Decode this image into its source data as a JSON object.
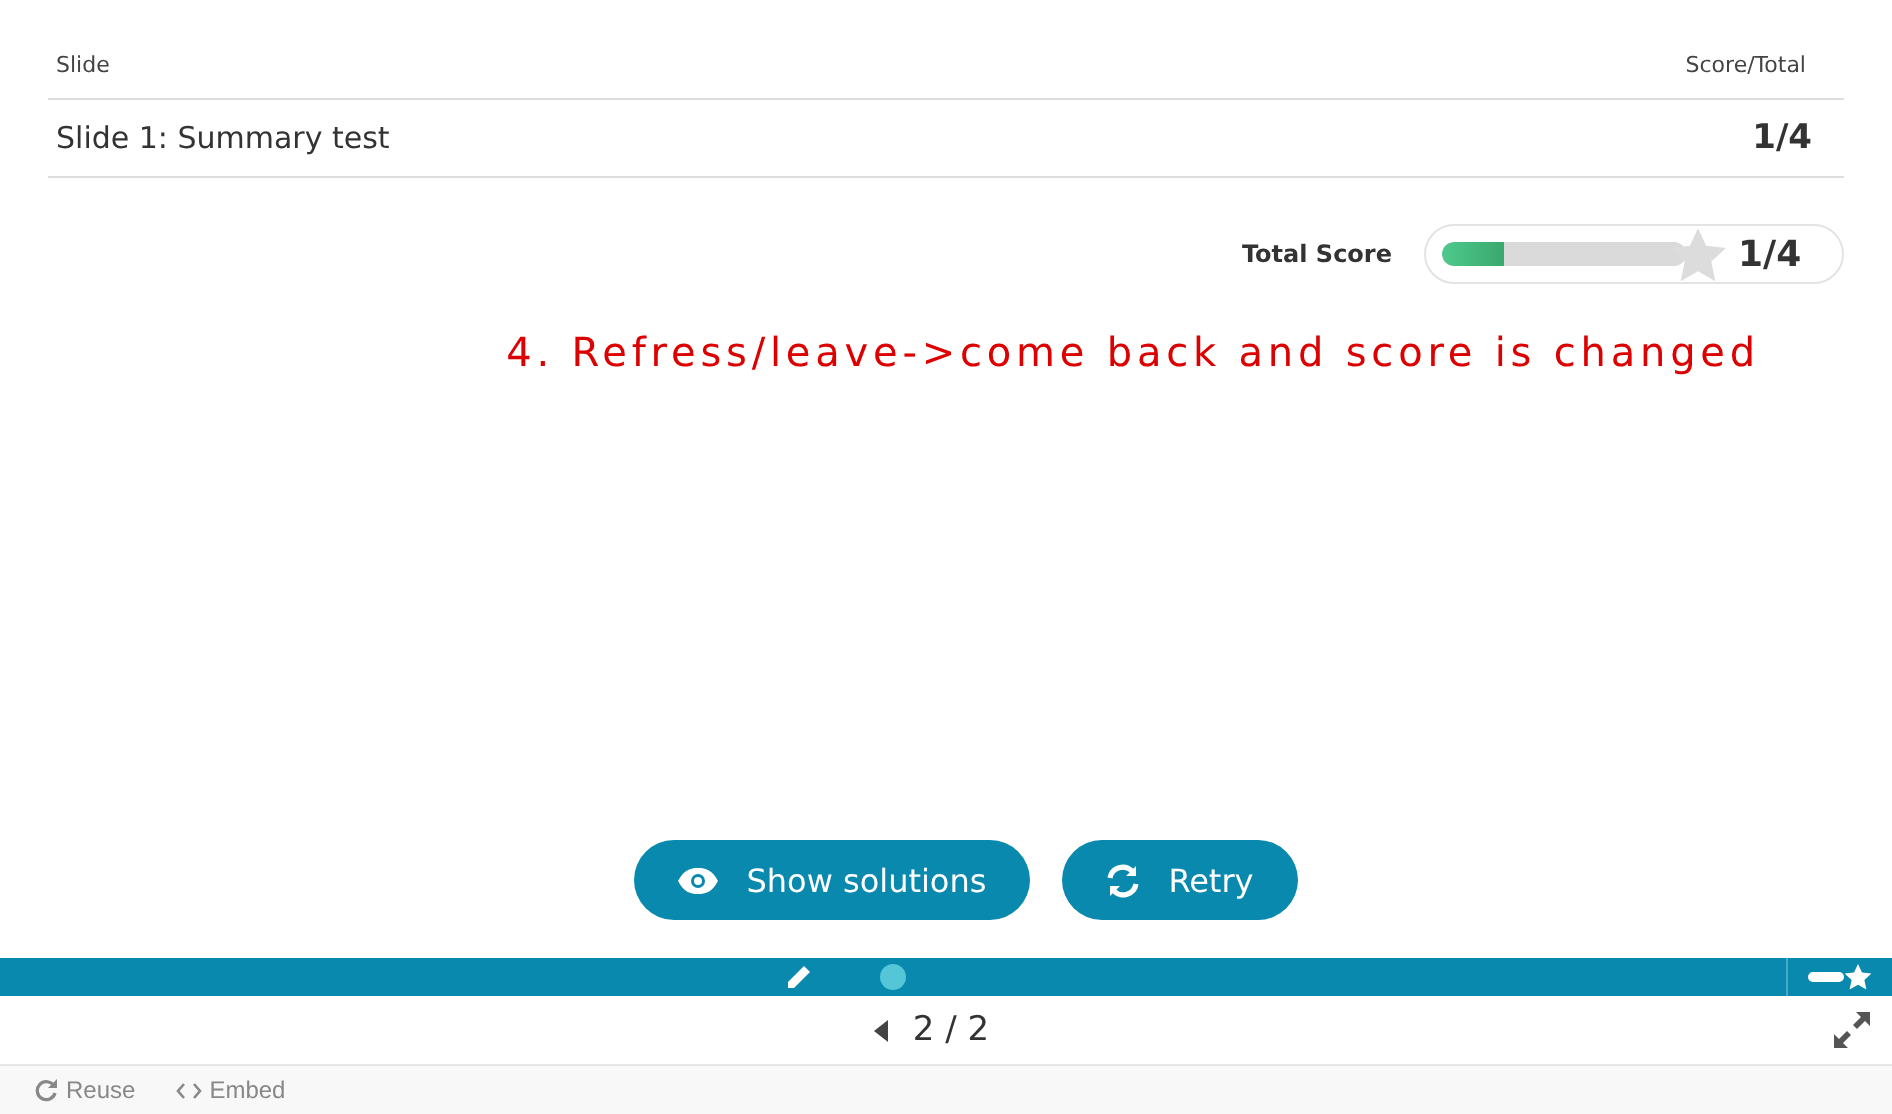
{
  "table": {
    "columns": [
      "Slide",
      "Score/Total"
    ],
    "rows": [
      {
        "slide": "Slide 1: Summary test",
        "score": "1/4"
      }
    ]
  },
  "total_score": {
    "label": "Total Score",
    "level": 0.25,
    "score": "1/4"
  },
  "annotation": "4. Refress/leave->come back and score is changed",
  "buttons": [
    {
      "label": "Show solutions",
      "kind": "eye"
    },
    {
      "label": "Retry",
      "kind": "retry"
    }
  ],
  "navigation": {
    "page": "2 / 2"
  },
  "footer": [
    {
      "label": "Reuse",
      "kind": "reuse"
    },
    {
      "label": "Embed",
      "kind": "embed"
    }
  ]
}
